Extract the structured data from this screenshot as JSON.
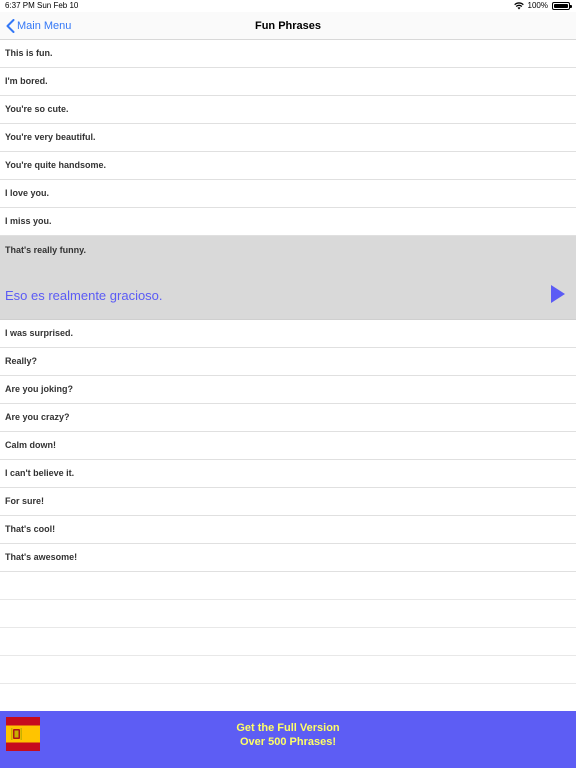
{
  "status_bar": {
    "time": "6:37 PM",
    "date": "Sun Feb 10",
    "battery": "100%"
  },
  "nav": {
    "back_label": "Main Menu",
    "title": "Fun Phrases"
  },
  "phrases_before": [
    "This is fun.",
    "I'm bored.",
    "You're so cute.",
    "You're very beautiful.",
    "You're quite handsome.",
    "I love you.",
    "I miss you."
  ],
  "selected": {
    "english": "That's really funny.",
    "translation": "Eso es realmente gracioso."
  },
  "phrases_after": [
    "I was surprised.",
    "Really?",
    "Are you joking?",
    "Are you crazy?",
    "Calm down!",
    "I can't believe it.",
    "For sure!",
    "That's cool!",
    "That's awesome!"
  ],
  "banner": {
    "line1": "Get the Full Version",
    "line2": "Over 500 Phrases!"
  },
  "colors": {
    "accent": "#3478f6",
    "translation": "#5b5bf5",
    "banner_bg": "#5d5df4",
    "banner_text": "#ffff66",
    "selected_bg": "#d9d9d9"
  }
}
